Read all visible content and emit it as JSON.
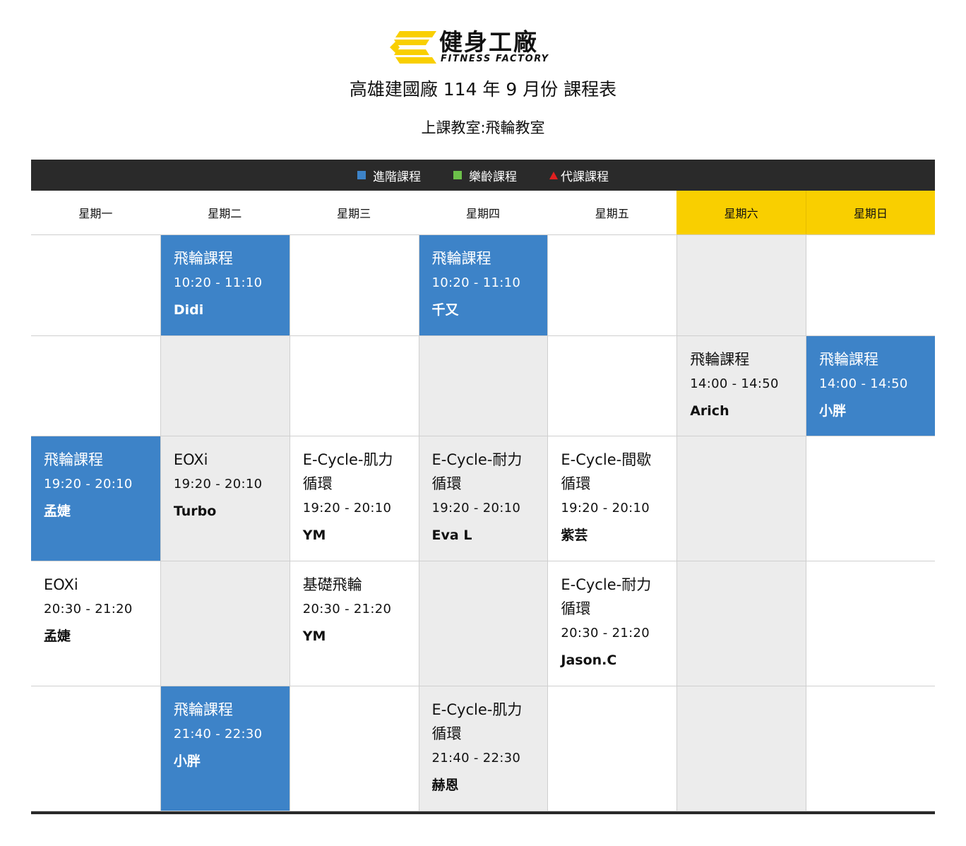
{
  "logo": {
    "name_cn": "健身工廠",
    "name_en": "FITNESS FACTORY",
    "colors": {
      "brand_yellow": "#f9cf00",
      "brand_dark": "#111111"
    }
  },
  "title": "高雄建國廠 114 年 9 月份 課程表",
  "subtitle": "上課教室:飛輪教室",
  "legend": [
    {
      "label": "進階課程",
      "marker": "square",
      "color": "#3d83c8"
    },
    {
      "label": "樂齡課程",
      "marker": "square",
      "color": "#6cc04a"
    },
    {
      "label": "代課課程",
      "marker": "triangle",
      "color": "#e02020"
    }
  ],
  "days": [
    "星期一",
    "星期二",
    "星期三",
    "星期四",
    "星期五",
    "星期六",
    "星期日"
  ],
  "colors": {
    "advanced_blue": "#3d83c8",
    "weekend_yellow": "#f9cf00",
    "empty_gray": "#ececec",
    "legend_bar": "#2a2a2a"
  },
  "rows": [
    {
      "cells": [
        {
          "style": "white"
        },
        {
          "style": "blue",
          "name": "飛輪課程",
          "time": "10:20 - 11:10",
          "teacher": "Didi"
        },
        {
          "style": "white"
        },
        {
          "style": "blue",
          "name": "飛輪課程",
          "time": "10:20 - 11:10",
          "teacher": "千又"
        },
        {
          "style": "white"
        },
        {
          "style": "gray"
        },
        {
          "style": "white"
        }
      ]
    },
    {
      "cells": [
        {
          "style": "white"
        },
        {
          "style": "gray"
        },
        {
          "style": "white"
        },
        {
          "style": "gray"
        },
        {
          "style": "white"
        },
        {
          "style": "gray",
          "name": "飛輪課程",
          "time": "14:00 - 14:50",
          "teacher": "Arich"
        },
        {
          "style": "blue",
          "name": "飛輪課程",
          "time": "14:00 - 14:50",
          "teacher": "小胖"
        }
      ]
    },
    {
      "cells": [
        {
          "style": "blue",
          "name": "飛輪課程",
          "time": "19:20 - 20:10",
          "teacher": "孟婕"
        },
        {
          "style": "gray",
          "name": "EOXi",
          "time": "19:20 - 20:10",
          "teacher": "Turbo"
        },
        {
          "style": "white",
          "name": "E-Cycle-肌力循環",
          "time": "19:20 - 20:10",
          "teacher": "YM"
        },
        {
          "style": "gray",
          "name": "E-Cycle-耐力循環",
          "time": "19:20 - 20:10",
          "teacher": "Eva L"
        },
        {
          "style": "white",
          "name": "E-Cycle-間歇循環",
          "time": "19:20 - 20:10",
          "teacher": "紫芸"
        },
        {
          "style": "gray"
        },
        {
          "style": "white"
        }
      ]
    },
    {
      "cells": [
        {
          "style": "white",
          "name": "EOXi",
          "time": "20:30 - 21:20",
          "teacher": "孟婕"
        },
        {
          "style": "gray"
        },
        {
          "style": "white",
          "name": "基礎飛輪",
          "time": "20:30 - 21:20",
          "teacher": "YM"
        },
        {
          "style": "gray"
        },
        {
          "style": "white",
          "name": "E-Cycle-耐力循環",
          "time": "20:30 - 21:20",
          "teacher": "Jason.C"
        },
        {
          "style": "gray"
        },
        {
          "style": "white"
        }
      ]
    },
    {
      "cells": [
        {
          "style": "white"
        },
        {
          "style": "blue",
          "name": "飛輪課程",
          "time": "21:40 - 22:30",
          "teacher": "小胖"
        },
        {
          "style": "white"
        },
        {
          "style": "gray",
          "name": "E-Cycle-肌力循環",
          "time": "21:40 - 22:30",
          "teacher": "赫恩"
        },
        {
          "style": "white"
        },
        {
          "style": "gray"
        },
        {
          "style": "white"
        }
      ]
    }
  ]
}
